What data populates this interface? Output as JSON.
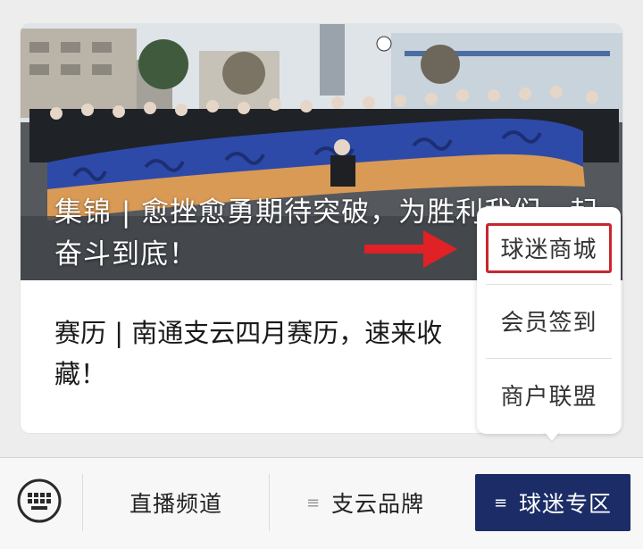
{
  "articles": [
    {
      "title": "集锦 | 愈挫愈勇期待突破，为胜利我们一起奋斗到底！"
    },
    {
      "title": "赛历 | 南通支云四月赛历，速来收藏！"
    }
  ],
  "popup_menu": {
    "items": [
      {
        "label": "球迷商城",
        "highlighted": true
      },
      {
        "label": "会员签到"
      },
      {
        "label": "商户联盟"
      }
    ],
    "highlight_color": "#c8262f"
  },
  "bottom_nav": {
    "keyboard_icon": "keyboard-icon",
    "tabs": [
      {
        "label": "直播频道",
        "has_menu": false
      },
      {
        "label": "支云品牌",
        "has_menu": true
      },
      {
        "label": "球迷专区",
        "has_menu": true,
        "active": true
      }
    ],
    "menu_glyph": "≡",
    "active_color": "#1b2c66"
  }
}
